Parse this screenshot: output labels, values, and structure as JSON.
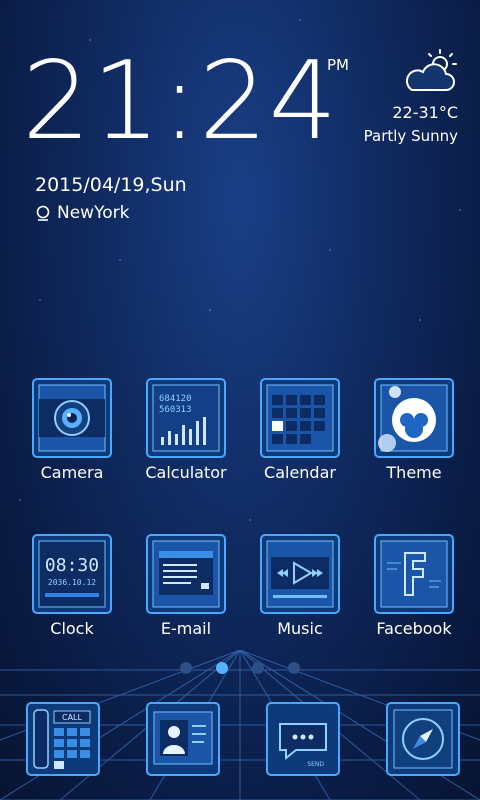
{
  "clock": {
    "time": "21:24",
    "ampm": "PM",
    "date": "2015/04/19,Sun",
    "location": "NewYork"
  },
  "weather": {
    "temp": "22-31°C",
    "condition": "Partly Sunny",
    "icon": "partly-cloudy-icon"
  },
  "apps": [
    {
      "label": "Camera",
      "icon": "camera-icon"
    },
    {
      "label": "Calculator",
      "icon": "calculator-icon"
    },
    {
      "label": "Calendar",
      "icon": "calendar-icon"
    },
    {
      "label": "Theme",
      "icon": "theme-icon"
    },
    {
      "label": "Clock",
      "icon": "clock-icon"
    },
    {
      "label": "E-mail",
      "icon": "email-icon"
    },
    {
      "label": "Music",
      "icon": "music-icon"
    },
    {
      "label": "Facebook",
      "icon": "facebook-icon"
    }
  ],
  "tile_text": {
    "calc_display_1": "684120",
    "calc_display_2": "560313",
    "clock_time": "08:30",
    "clock_date": "2036.10.12",
    "call_label": "CALL",
    "send_label": "SEND"
  },
  "page_indicator": {
    "count": 4,
    "active": 2
  },
  "dock": [
    {
      "icon": "phone-icon"
    },
    {
      "icon": "contacts-icon"
    },
    {
      "icon": "messaging-icon"
    },
    {
      "icon": "browser-icon"
    }
  ],
  "colors": {
    "accent": "#56b2ff",
    "tile_border": "#4aa8ff",
    "tile_fill": "#113a78"
  }
}
